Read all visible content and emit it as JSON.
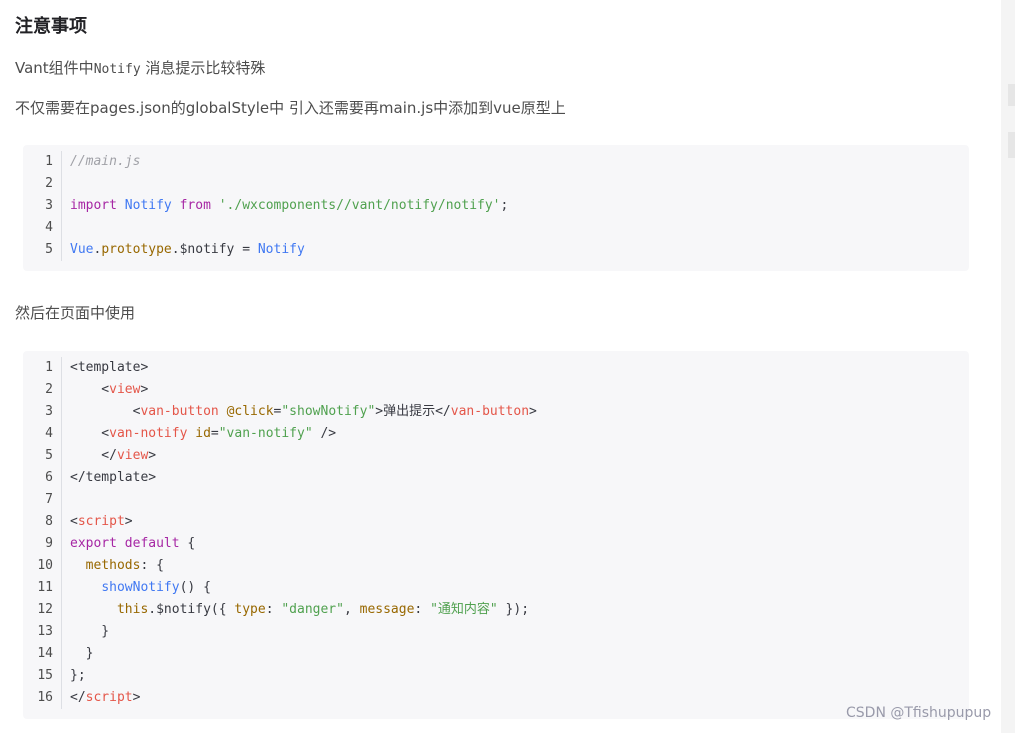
{
  "article": {
    "heading": "注意事项",
    "para1_prefix": "Vant组件中",
    "para1_code": "Notify",
    "para1_suffix": " 消息提示比较特殊",
    "para2": "不仅需要在pages.json的globalStyle中 引入还需要再main.js中添加到vue原型上",
    "para3": "然后在页面中使用"
  },
  "code1": [
    {
      "n": "1",
      "tokens": [
        {
          "c": "t-comment",
          "t": "//main.js"
        }
      ]
    },
    {
      "n": "2",
      "tokens": []
    },
    {
      "n": "3",
      "tokens": [
        {
          "c": "t-kw",
          "t": "import"
        },
        {
          "c": "t-plain",
          "t": " "
        },
        {
          "c": "t-fn",
          "t": "Notify"
        },
        {
          "c": "t-plain",
          "t": " "
        },
        {
          "c": "t-kw",
          "t": "from"
        },
        {
          "c": "t-plain",
          "t": " "
        },
        {
          "c": "t-str",
          "t": "'./wxcomponents//vant/notify/notify'"
        },
        {
          "c": "t-plain",
          "t": ";"
        }
      ]
    },
    {
      "n": "4",
      "tokens": []
    },
    {
      "n": "5",
      "tokens": [
        {
          "c": "t-fn",
          "t": "Vue"
        },
        {
          "c": "t-plain",
          "t": "."
        },
        {
          "c": "t-attr",
          "t": "prototype"
        },
        {
          "c": "t-plain",
          "t": ".$notify = "
        },
        {
          "c": "t-fn",
          "t": "Notify"
        }
      ]
    }
  ],
  "code2": [
    {
      "n": "1",
      "tokens": [
        {
          "c": "t-plain",
          "t": "<template>"
        }
      ]
    },
    {
      "n": "2",
      "tokens": [
        {
          "c": "t-plain",
          "t": "    <"
        },
        {
          "c": "t-tag",
          "t": "view"
        },
        {
          "c": "t-plain",
          "t": ">"
        }
      ]
    },
    {
      "n": "3",
      "tokens": [
        {
          "c": "t-plain",
          "t": "        <"
        },
        {
          "c": "t-tag",
          "t": "van-button"
        },
        {
          "c": "t-plain",
          "t": " "
        },
        {
          "c": "t-attr",
          "t": "@click"
        },
        {
          "c": "t-plain",
          "t": "="
        },
        {
          "c": "t-str",
          "t": "\"showNotify\""
        },
        {
          "c": "t-plain",
          "t": ">弹出提示</"
        },
        {
          "c": "t-tag",
          "t": "van-button"
        },
        {
          "c": "t-plain",
          "t": ">"
        }
      ]
    },
    {
      "n": "4",
      "tokens": [
        {
          "c": "t-plain",
          "t": "    <"
        },
        {
          "c": "t-tag",
          "t": "van-notify"
        },
        {
          "c": "t-plain",
          "t": " "
        },
        {
          "c": "t-attr",
          "t": "id"
        },
        {
          "c": "t-plain",
          "t": "="
        },
        {
          "c": "t-str",
          "t": "\"van-notify\""
        },
        {
          "c": "t-plain",
          "t": " />"
        }
      ]
    },
    {
      "n": "5",
      "tokens": [
        {
          "c": "t-plain",
          "t": "    </"
        },
        {
          "c": "t-tag",
          "t": "view"
        },
        {
          "c": "t-plain",
          "t": ">"
        }
      ]
    },
    {
      "n": "6",
      "tokens": [
        {
          "c": "t-plain",
          "t": "</template>"
        }
      ]
    },
    {
      "n": "7",
      "tokens": []
    },
    {
      "n": "8",
      "tokens": [
        {
          "c": "t-plain",
          "t": "<"
        },
        {
          "c": "t-tag",
          "t": "script"
        },
        {
          "c": "t-plain",
          "t": ">"
        }
      ]
    },
    {
      "n": "9",
      "tokens": [
        {
          "c": "t-kw",
          "t": "export"
        },
        {
          "c": "t-plain",
          "t": " "
        },
        {
          "c": "t-kw",
          "t": "default"
        },
        {
          "c": "t-plain",
          "t": " {"
        }
      ]
    },
    {
      "n": "10",
      "tokens": [
        {
          "c": "t-plain",
          "t": "  "
        },
        {
          "c": "t-attr",
          "t": "methods"
        },
        {
          "c": "t-plain",
          "t": ": {"
        }
      ]
    },
    {
      "n": "11",
      "tokens": [
        {
          "c": "t-plain",
          "t": "    "
        },
        {
          "c": "t-fn",
          "t": "showNotify"
        },
        {
          "c": "t-plain",
          "t": "() {"
        }
      ]
    },
    {
      "n": "12",
      "tokens": [
        {
          "c": "t-plain",
          "t": "      "
        },
        {
          "c": "t-attr",
          "t": "this"
        },
        {
          "c": "t-plain",
          "t": ".$notify({ "
        },
        {
          "c": "t-attr",
          "t": "type"
        },
        {
          "c": "t-plain",
          "t": ": "
        },
        {
          "c": "t-str",
          "t": "\"danger\""
        },
        {
          "c": "t-plain",
          "t": ", "
        },
        {
          "c": "t-attr",
          "t": "message"
        },
        {
          "c": "t-plain",
          "t": ": "
        },
        {
          "c": "t-str",
          "t": "\"通知内容\""
        },
        {
          "c": "t-plain",
          "t": " });"
        }
      ]
    },
    {
      "n": "13",
      "tokens": [
        {
          "c": "t-plain",
          "t": "    }"
        }
      ]
    },
    {
      "n": "14",
      "tokens": [
        {
          "c": "t-plain",
          "t": "  }"
        }
      ]
    },
    {
      "n": "15",
      "tokens": [
        {
          "c": "t-plain",
          "t": "};"
        }
      ]
    },
    {
      "n": "16",
      "tokens": [
        {
          "c": "t-plain",
          "t": "</"
        },
        {
          "c": "t-tag",
          "t": "script"
        },
        {
          "c": "t-plain",
          "t": ">"
        }
      ]
    }
  ],
  "watermark": "CSDN @Tfishupupup"
}
